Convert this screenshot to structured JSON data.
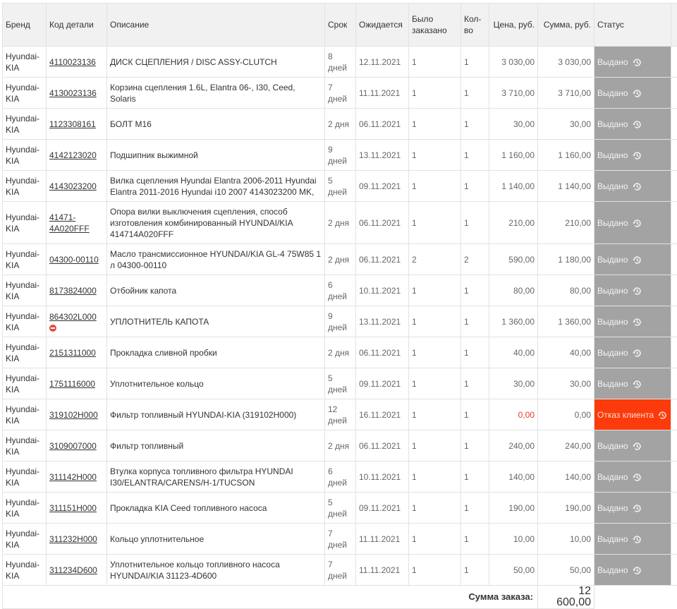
{
  "columns": {
    "brand": "Бренд",
    "code": "Код детали",
    "description": "Описание",
    "term": "Срок",
    "expected": "Ожидается",
    "ordered": "Было заказано",
    "qty": "Кол-во",
    "price": "Цена, руб.",
    "sum": "Сумма, руб.",
    "status": "Статус"
  },
  "rows": [
    {
      "brand": "Hyundai-KIA",
      "code": "4110023136",
      "description": "ДИСК СЦЕПЛЕНИЯ / DISC ASSY-CLUTCH",
      "term": "8 дней",
      "expected": "12.11.2021",
      "ordered": "1",
      "qty": "1",
      "price": "3 030,00",
      "sum": "3 030,00",
      "status": "Выдано"
    },
    {
      "brand": "Hyundai-KIA",
      "code": "4130023136",
      "description": "Корзина сцепления 1.6L, Elantra 06-, I30, Ceed, Solaris",
      "term": "7 дней",
      "expected": "11.11.2021",
      "ordered": "1",
      "qty": "1",
      "price": "3 710,00",
      "sum": "3 710,00",
      "status": "Выдано"
    },
    {
      "brand": "Hyundai-KIA",
      "code": "1123308161",
      "description": "БОЛТ M16",
      "term": "2 дня",
      "expected": "06.11.2021",
      "ordered": "1",
      "qty": "1",
      "price": "30,00",
      "sum": "30,00",
      "status": "Выдано"
    },
    {
      "brand": "Hyundai-KIA",
      "code": "4142123020",
      "description": "Подшипник выжимной",
      "term": "9 дней",
      "expected": "13.11.2021",
      "ordered": "1",
      "qty": "1",
      "price": "1 160,00",
      "sum": "1 160,00",
      "status": "Выдано"
    },
    {
      "brand": "Hyundai-KIA",
      "code": "4143023200",
      "description": "Вилка сцепления Hyundai Elantra 2006-2011 Hyundai Elantra 2011-2016 Hyundai i10 2007 4143023200 MK,",
      "term": "5 дней",
      "expected": "09.11.2021",
      "ordered": "1",
      "qty": "1",
      "price": "1 140,00",
      "sum": "1 140,00",
      "status": "Выдано"
    },
    {
      "brand": "Hyundai-KIA",
      "code": "41471-4A020FFF",
      "description": "Опора вилки выключения сцепления, способ изготовления комбинированный HYUNDAI/KIA 414714A020FFF",
      "term": "2 дня",
      "expected": "06.11.2021",
      "ordered": "1",
      "qty": "1",
      "price": "210,00",
      "sum": "210,00",
      "status": "Выдано",
      "tall": true
    },
    {
      "brand": "Hyundai-KIA",
      "code": "04300-00110",
      "description": "Масло трансмиссионное HYUNDAI/KIA GL-4 75W85 1 л 04300-00110",
      "term": "2 дня",
      "expected": "06.11.2021",
      "ordered": "2",
      "qty": "2",
      "price": "590,00",
      "sum": "1 180,00",
      "status": "Выдано"
    },
    {
      "brand": "Hyundai-KIA",
      "code": "8173824000",
      "description": "Отбойник капота",
      "term": "6 дней",
      "expected": "10.11.2021",
      "ordered": "1",
      "qty": "1",
      "price": "80,00",
      "sum": "80,00",
      "status": "Выдано"
    },
    {
      "brand": "Hyundai-KIA",
      "code": "864302L000",
      "description": "УПЛОТНИТЕЛЬ КАПОТА",
      "term": "9 дней",
      "expected": "13.11.2021",
      "ordered": "1",
      "qty": "1",
      "price": "1 360,00",
      "sum": "1 360,00",
      "status": "Выдано",
      "blocked": true
    },
    {
      "brand": "Hyundai-KIA",
      "code": "2151311000",
      "description": "Прокладка сливной пробки",
      "term": "2 дня",
      "expected": "06.11.2021",
      "ordered": "1",
      "qty": "1",
      "price": "40,00",
      "sum": "40,00",
      "status": "Выдано"
    },
    {
      "brand": "Hyundai-KIA",
      "code": "1751116000",
      "description": "Уплотнительное кольцо",
      "term": "5 дней",
      "expected": "09.11.2021",
      "ordered": "1",
      "qty": "1",
      "price": "30,00",
      "sum": "30,00",
      "status": "Выдано"
    },
    {
      "brand": "Hyundai-KIA",
      "code": "319102H000",
      "description": "Фильтр топливный HYUNDAI-KIA (319102H000)",
      "term": "12 дней",
      "expected": "16.11.2021",
      "ordered": "1",
      "qty": "1",
      "price": "0,00",
      "sum": "0,00",
      "status": "Отказ клиента",
      "refused": true
    },
    {
      "brand": "Hyundai-KIA",
      "code": "3109007000",
      "description": "Фильтр топливный",
      "term": "2 дня",
      "expected": "06.11.2021",
      "ordered": "1",
      "qty": "1",
      "price": "240,00",
      "sum": "240,00",
      "status": "Выдано"
    },
    {
      "brand": "Hyundai-KIA",
      "code": "311142H000",
      "description": "Втулка корпуса топливного фильтра HYUNDAI I30/ELANTRA/CARENS/H-1/TUCSON",
      "term": "6 дней",
      "expected": "10.11.2021",
      "ordered": "1",
      "qty": "1",
      "price": "140,00",
      "sum": "140,00",
      "status": "Выдано"
    },
    {
      "brand": "Hyundai-KIA",
      "code": "311151H000",
      "description": "Прокладка KIA Ceed топливного насоса",
      "term": "5 дней",
      "expected": "09.11.2021",
      "ordered": "1",
      "qty": "1",
      "price": "190,00",
      "sum": "190,00",
      "status": "Выдано"
    },
    {
      "brand": "Hyundai-KIA",
      "code": "311232H000",
      "description": "Кольцо уплотнительное",
      "term": "7 дней",
      "expected": "11.11.2021",
      "ordered": "1",
      "qty": "1",
      "price": "10,00",
      "sum": "10,00",
      "status": "Выдано"
    },
    {
      "brand": "Hyundai-KIA",
      "code": "311234D600",
      "description": "Уплотнительное кольцо топливного насоса HYUNDAI/KIA 31123-4D600",
      "term": "7 дней",
      "expected": "11.11.2021",
      "ordered": "1",
      "qty": "1",
      "price": "50,00",
      "sum": "50,00",
      "status": "Выдано"
    }
  ],
  "footer": {
    "total_label": "Сумма заказа:",
    "total_value": "12 600,00"
  },
  "colors": {
    "status_issued": "#a3a3a3",
    "status_refused": "#fb3b0b",
    "zero_price": "#e53b2c"
  },
  "icons": {
    "history": "history-icon",
    "blocked": "no-entry-icon"
  }
}
